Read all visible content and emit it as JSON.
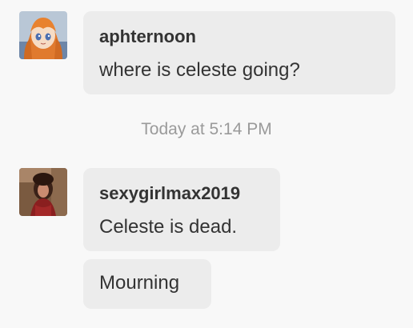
{
  "messages_top": {
    "username": "aphternoon",
    "text": "where is celeste going?",
    "avatar_icon": "anime-girl-avatar"
  },
  "divider": {
    "timestamp": "Today at 5:14 PM"
  },
  "messages_bottom": {
    "username": "sexygirlmax2019",
    "text": "Celeste is dead.",
    "text_2": "Mourning",
    "avatar_icon": "photo-avatar"
  },
  "colors": {
    "background": "#f8f8f8",
    "bubble": "#ececec",
    "text": "#333333",
    "timestamp": "#9a9a9a"
  }
}
